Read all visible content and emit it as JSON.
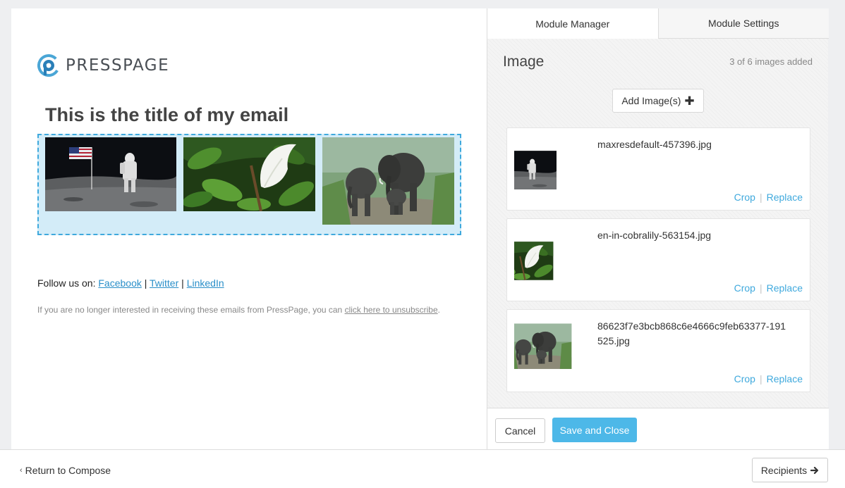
{
  "email": {
    "logo_text": "PRESSPAGE",
    "title": "This is the title of my email",
    "follow_label": "Follow us on:",
    "social_links": [
      "Facebook",
      "Twitter",
      "LinkedIn"
    ],
    "separator": "|",
    "unsubscribe_text": "If you are no longer interested in receiving these emails from PressPage, you can",
    "unsubscribe_link": "click here to unsubscribe",
    "unsubscribe_end": "."
  },
  "panel": {
    "tabs": [
      {
        "label": "Module Manager",
        "active": true
      },
      {
        "label": "Module Settings",
        "active": false
      }
    ],
    "title": "Image",
    "image_count": "3 of 6 images added",
    "add_button": "Add Image(s)",
    "images": [
      {
        "filename": "maxresdefault-457396.jpg",
        "crop": "Crop",
        "replace": "Replace"
      },
      {
        "filename": "en-in-cobralily-563154.jpg",
        "crop": "Crop",
        "replace": "Replace"
      },
      {
        "filename": "86623f7e3bcb868c6e4666c9feb63377-191525.jpg",
        "crop": "Crop",
        "replace": "Replace"
      }
    ],
    "cancel_label": "Cancel",
    "save_label": "Save and Close"
  },
  "footer": {
    "return_label": "Return to Compose",
    "recipients_label": "Recipients"
  },
  "colors": {
    "accent": "#3fa9dd",
    "save_button": "#4db8e8",
    "module_highlight": "#d3ecf8"
  }
}
